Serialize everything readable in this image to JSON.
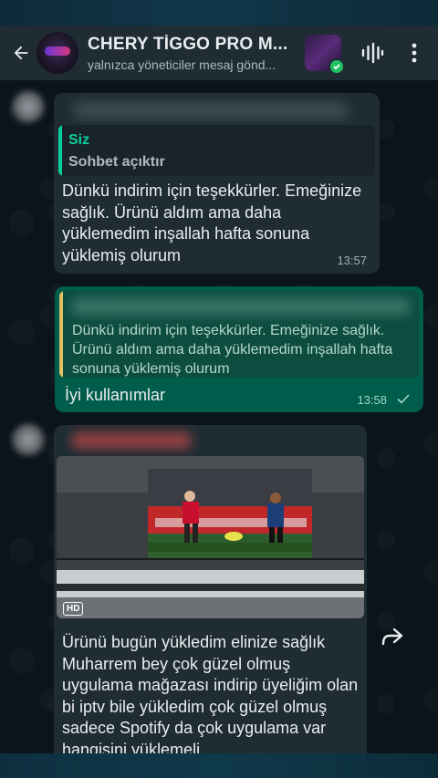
{
  "header": {
    "title": "CHERY TİGGO PRO M...",
    "subtitle": "yalnızca yöneticiler mesaj gönd..."
  },
  "messages": [
    {
      "type": "incoming",
      "quote": {
        "name": "Siz",
        "text": "Sohbet açıktır"
      },
      "text": "Dünkü indirim için teşekkürler. Emeğinize sağlık. Ürünü aldım ama daha yüklemedim inşallah hafta sonuna yüklemiş olurum",
      "time": "13:57"
    },
    {
      "type": "outgoing",
      "quote": {
        "text": "Dünkü indirim için teşekkürler. Emeğinize sağlık. Ürünü aldım ama daha yüklemedim inşallah hafta sonuna yüklemiş olurum"
      },
      "text": "İyi kullanımlar",
      "time": "13:58",
      "status": "sent-check-icon"
    },
    {
      "type": "incoming-media",
      "media_badge": "HD",
      "text": "Ürünü bugün yükledim elinize sağlık Muharrem bey çok güzel olmuş uygulama mağazası indirip  üyeliğim olan bi iptv bile yükledim çok güzel olmuş sadece Spotify da çok uygulama var hangisini  yüklemeli"
    }
  ],
  "colors": {
    "header_bg": "#1f2c33",
    "incoming_bubble": "#1f2c33",
    "outgoing_bubble": "#005c4b",
    "accent": "#06cf9c"
  }
}
